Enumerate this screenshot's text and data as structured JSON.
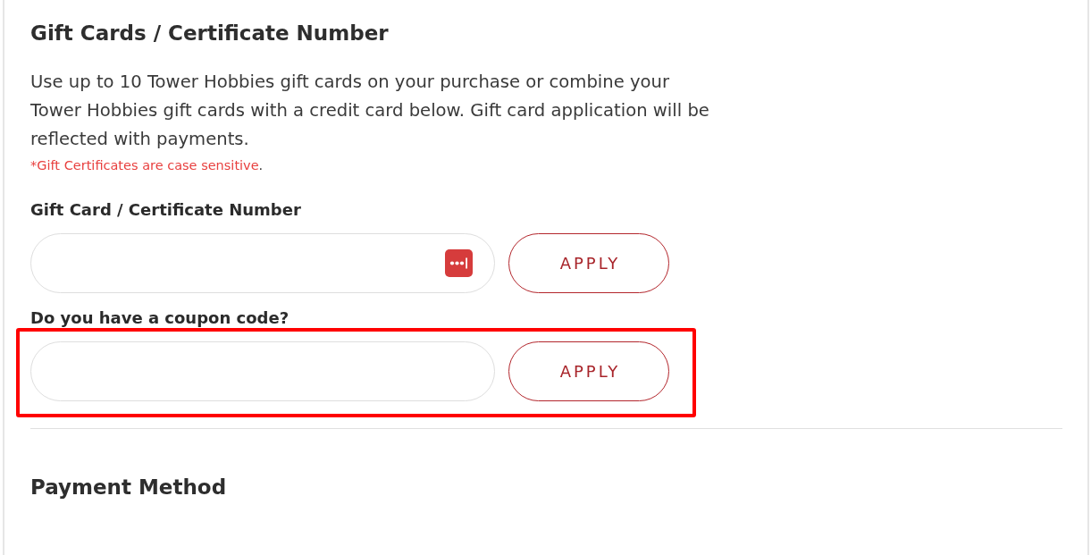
{
  "section": {
    "title": "Gift Cards / Certificate Number",
    "description": "Use up to 10 Tower Hobbies gift cards on your purchase or combine your Tower Hobbies gift cards with a credit card below. Gift card application will be reflected with payments.",
    "note": {
      "text": "*Gift Certificates are case sensitive",
      "suffix": "."
    }
  },
  "code_rows": [
    {
      "label": "Gift Card / Certificate Number",
      "autofill_icon": true,
      "button": "APPLY",
      "highlighted": false
    },
    {
      "label": "Do you have a coupon code?",
      "autofill_icon": false,
      "button": "APPLY",
      "highlighted": true
    }
  ],
  "next_section": {
    "title": "Payment Method"
  }
}
